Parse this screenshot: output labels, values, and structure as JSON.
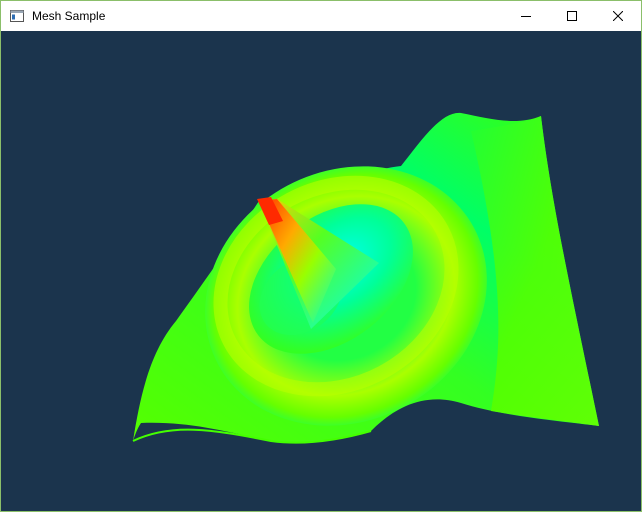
{
  "window": {
    "title": "Mesh Sample",
    "icon": "app-window-icon",
    "frame_border_color": "#8bbf6a"
  },
  "titlebar": {
    "minimize_icon": "minimize-icon",
    "maximize_icon": "maximize-icon",
    "close_icon": "close-icon"
  },
  "viewport": {
    "background_color": "#1b344d",
    "content": "3d-mesh-surface",
    "colors": {
      "base": "#66ff00",
      "cool": "#00ffcc",
      "cyan": "#00ffff",
      "warm": "#ffee00",
      "hot": "#ff4400"
    }
  }
}
